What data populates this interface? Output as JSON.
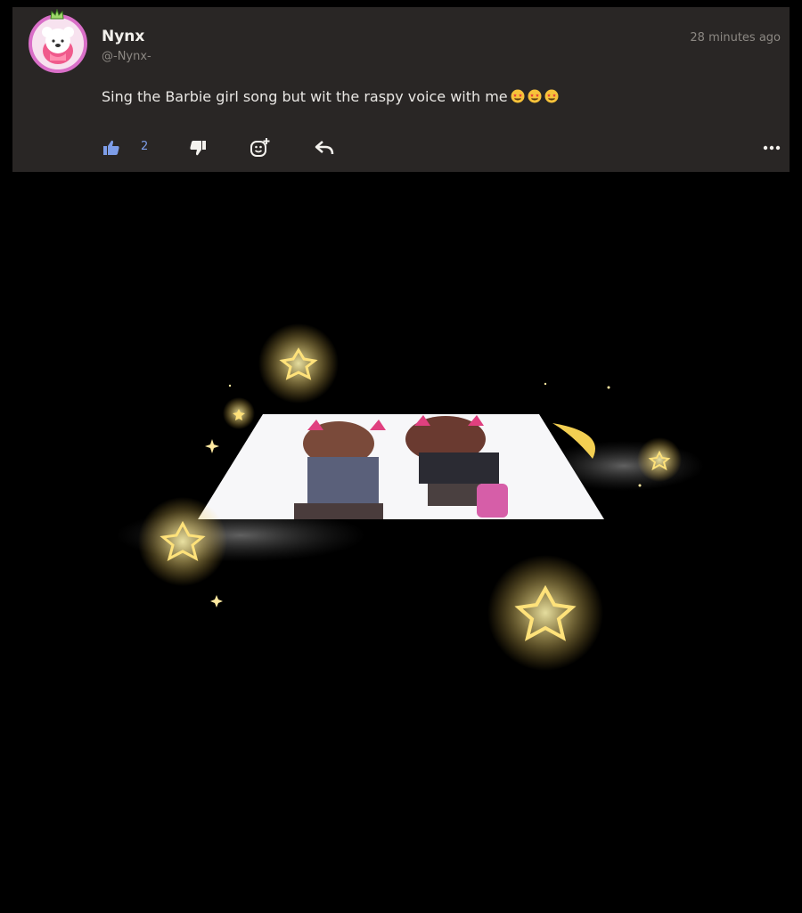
{
  "post": {
    "author": {
      "name": "Nynx",
      "handle": "@-Nynx-"
    },
    "timestamp": "28 minutes ago",
    "body": "Sing the Barbie girl song but wit the raspy voice with me",
    "emoji_count": 3,
    "actions": {
      "like_icon": "thumbs-up-icon",
      "like_count": "2",
      "dislike_icon": "thumbs-down-icon",
      "react_icon": "add-reaction-icon",
      "reply_icon": "reply-icon",
      "more_icon": "more-horizontal-icon"
    },
    "colors": {
      "card_bg": "#292625",
      "like_active": "#7d9de8",
      "avatar_ring": "#d96fc8"
    }
  }
}
